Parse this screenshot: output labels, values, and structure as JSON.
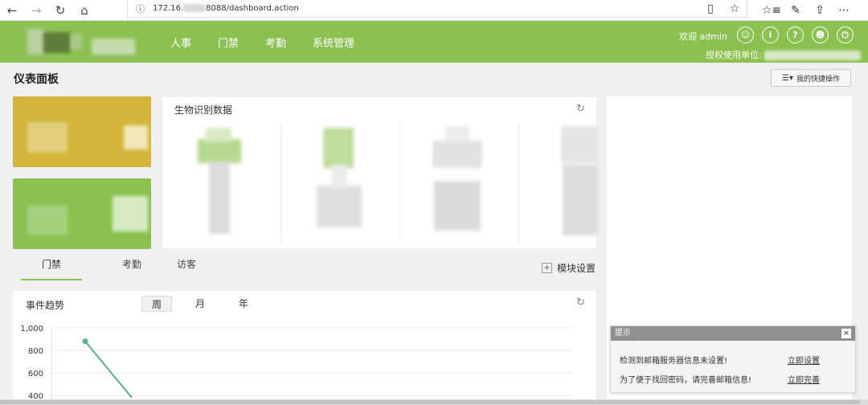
{
  "browser": {
    "back": "←",
    "forward": "→",
    "reload": "↻",
    "home": "⌂",
    "info_icon": "ⓘ",
    "url_prefix": "172.16.",
    "url_suffix": "8088/dashboard.action",
    "reading_view": "▯",
    "favorite": "☆",
    "favorites_list": "☆≡",
    "notes": "✎",
    "share": "⇪",
    "more": "⋯"
  },
  "header": {
    "nav": [
      "人事",
      "门禁",
      "考勤",
      "系统管理"
    ],
    "welcome": "欢迎 admin",
    "auth_label": "授权使用单位:",
    "icons": [
      "user-icon",
      "info-icon",
      "help-icon",
      "account-icon",
      "power-icon"
    ]
  },
  "page": {
    "title": "仪表面板",
    "quick_ops": "我的快捷操作"
  },
  "bio": {
    "title": "生物识别数据",
    "refresh": "↻"
  },
  "tabs": [
    "门禁",
    "考勤",
    "访客"
  ],
  "module_settings": "模块设置",
  "trend": {
    "title": "事件趋势",
    "periods": [
      "周",
      "月",
      "年"
    ],
    "refresh": "↻"
  },
  "notice": {
    "title": "提示",
    "close": "×",
    "rows": [
      {
        "text": "检测到邮箱服务器信息未设置!",
        "link": "立即设置"
      },
      {
        "text": "为了便于找回密码，请完善邮箱信息!",
        "link": "立即完善"
      }
    ]
  },
  "chart_data": {
    "type": "line",
    "y_ticks": [
      "1,000",
      "800",
      "600",
      "400"
    ],
    "ylim": [
      400,
      1000
    ],
    "series": [
      {
        "values": [
          {
            "x": 0,
            "y": 880
          },
          {
            "x": 1,
            "y": 380
          }
        ]
      }
    ],
    "line_color": "#5bb08a",
    "grid": true
  },
  "colors": {
    "brand_green": "#8cc152",
    "card_yellow": "#d3b43a"
  }
}
